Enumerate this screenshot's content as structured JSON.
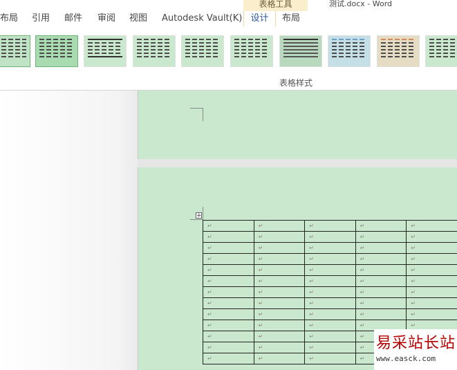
{
  "ribbon": {
    "context_title": "表格工具",
    "doc_title": "测试.docx - Word",
    "tabs": [
      {
        "label": "布局"
      },
      {
        "label": "引用"
      },
      {
        "label": "邮件"
      },
      {
        "label": "审阅"
      },
      {
        "label": "视图"
      },
      {
        "label": "Autodesk Vault(K)"
      },
      {
        "label": "设计"
      },
      {
        "label": "布局"
      }
    ],
    "active_tab": "设计",
    "group_label": "表格样式",
    "accent_color": "#2b579a",
    "context_color": "#fbeecc"
  },
  "document": {
    "background_color": "#c9e8cd",
    "table_handle_icon": "move-table-icon",
    "paragraph_mark": "↵",
    "table": {
      "rows": 13,
      "cols": 5
    }
  },
  "watermark": {
    "title": "易采站长站",
    "url": "www.easck.com"
  }
}
